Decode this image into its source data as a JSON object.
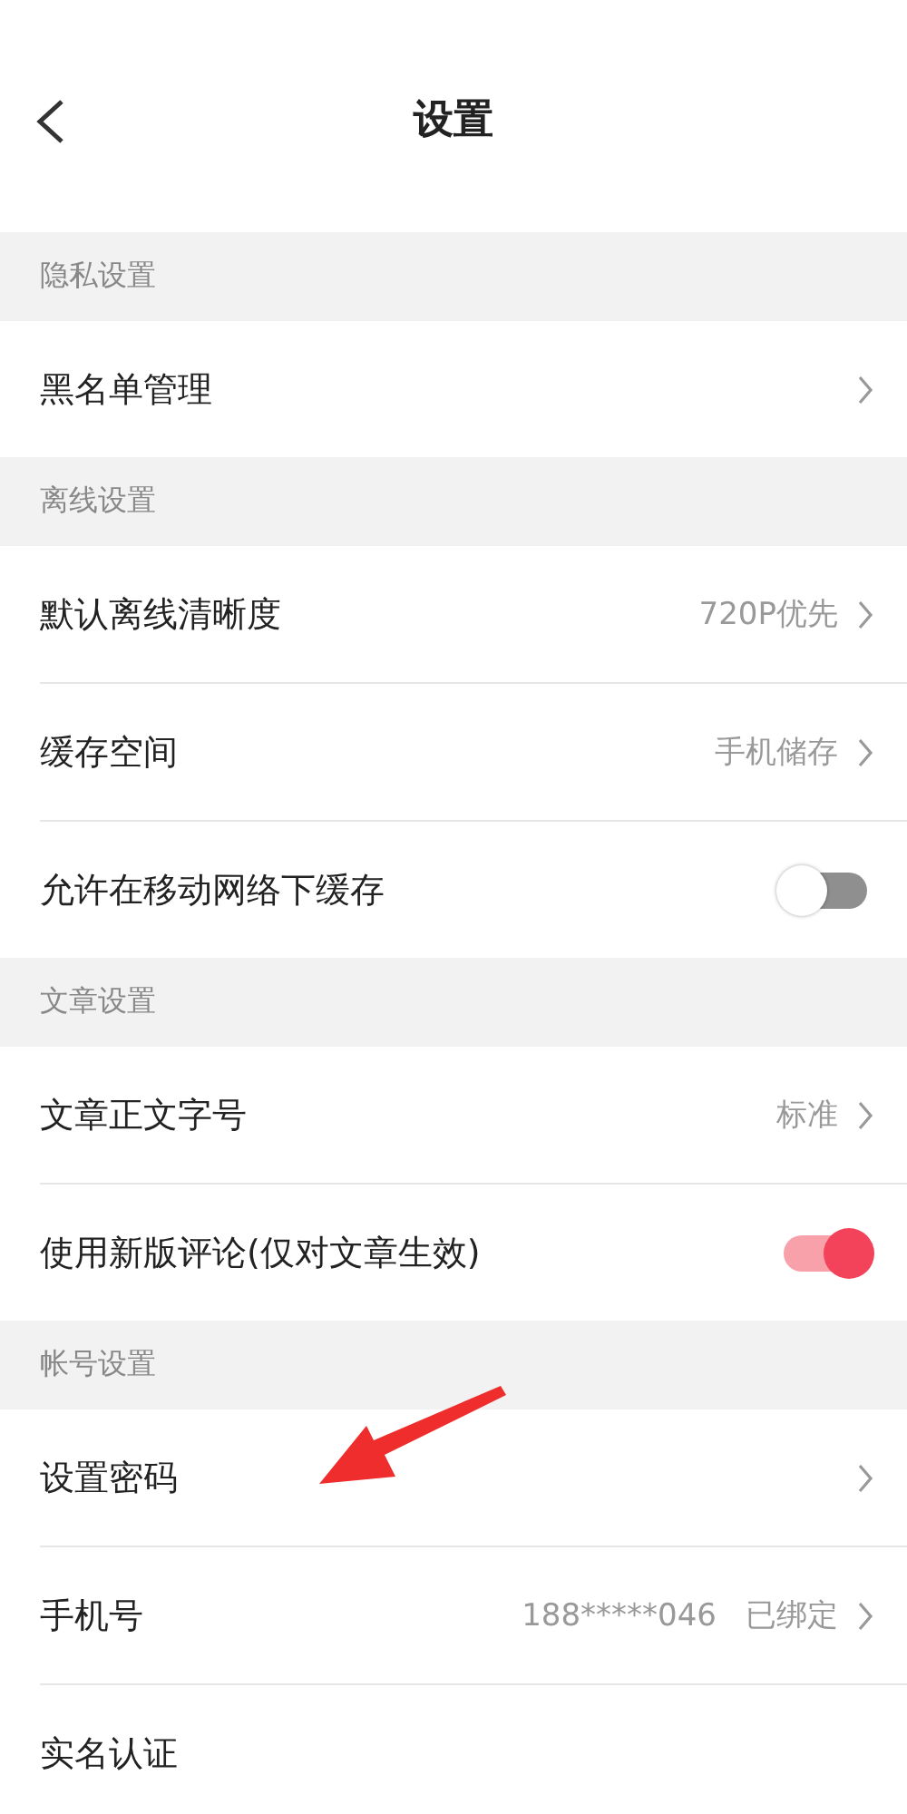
{
  "header": {
    "title": "设置"
  },
  "sections": [
    {
      "title": "隐私设置",
      "rows": [
        {
          "kind": "link",
          "label": "黑名单管理"
        }
      ]
    },
    {
      "title": "离线设置",
      "rows": [
        {
          "kind": "link",
          "label": "默认离线清晰度",
          "value": "720P优先"
        },
        {
          "kind": "link",
          "label": "缓存空间",
          "value": "手机储存"
        },
        {
          "kind": "toggle",
          "label": "允许在移动网络下缓存",
          "on": false
        }
      ]
    },
    {
      "title": "文章设置",
      "rows": [
        {
          "kind": "link",
          "label": "文章正文字号",
          "value": "标准"
        },
        {
          "kind": "toggle",
          "label": "使用新版评论(仅对文章生效)",
          "on": true
        }
      ]
    },
    {
      "title": "帐号设置",
      "rows": [
        {
          "kind": "link",
          "label": "设置密码"
        },
        {
          "kind": "link",
          "label": "手机号",
          "detail": "188*****046",
          "value": "已绑定"
        },
        {
          "kind": "plain",
          "label": "实名认证"
        }
      ]
    }
  ]
}
